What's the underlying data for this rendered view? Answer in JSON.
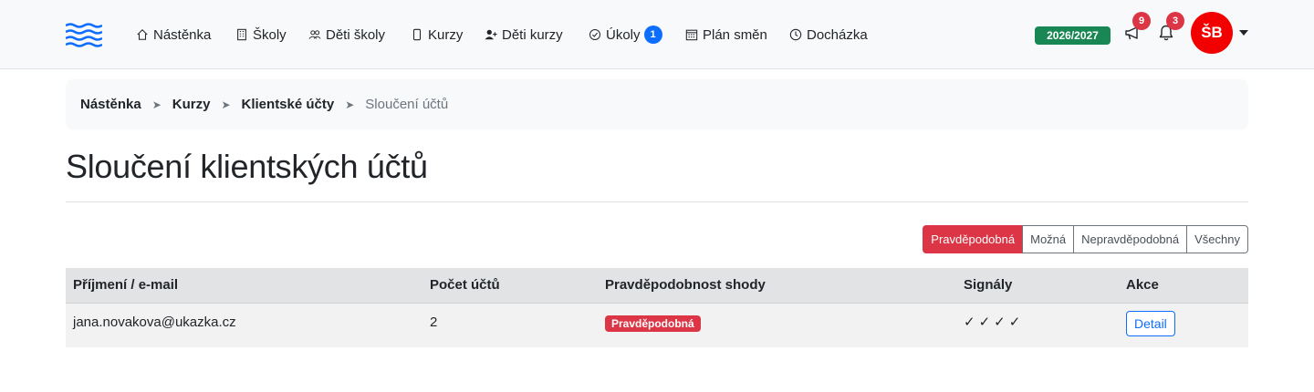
{
  "nav": {
    "items": [
      {
        "label": "Nástěnka",
        "icon": "home-icon"
      },
      {
        "label": "Školy",
        "icon": "building-icon"
      },
      {
        "label": "Děti školy",
        "icon": "people-icon"
      },
      {
        "label": "Kurzy",
        "icon": "phone-icon"
      },
      {
        "label": "Děti kurzy",
        "icon": "person-add-icon"
      },
      {
        "label": "Úkoly",
        "icon": "check-circle-icon",
        "count": "1"
      },
      {
        "label": "Plán směn",
        "icon": "calendar-icon"
      },
      {
        "label": "Docházka",
        "icon": "clock-icon"
      }
    ],
    "school_year": "2026/2027",
    "announcements_count": "9",
    "notifications_count": "3",
    "user_initials": "ŠB"
  },
  "breadcrumb": {
    "items": [
      "Nástěnka",
      "Kurzy",
      "Klientské účty"
    ],
    "current": "Sloučení účtů"
  },
  "page": {
    "title": "Sloučení klientských účtů"
  },
  "filters": {
    "options": [
      "Pravděpodobná",
      "Možná",
      "Nepravděpodobná",
      "Všechny"
    ],
    "active": "Pravděpodobná"
  },
  "table": {
    "headers": [
      "Příjmení / e-mail",
      "Počet účtů",
      "Pravděpodobnost shody",
      "Signály",
      "Akce"
    ],
    "rows": [
      {
        "identifier": "jana.novakova@ukazka.cz",
        "account_count": "2",
        "probability": "Pravděpodobná",
        "signals": "✓✓✓✓",
        "action": "Detail"
      }
    ]
  },
  "colors": {
    "danger": "#dc3545",
    "primary": "#0d6efd",
    "success": "#198754",
    "avatar": "#f20000"
  }
}
